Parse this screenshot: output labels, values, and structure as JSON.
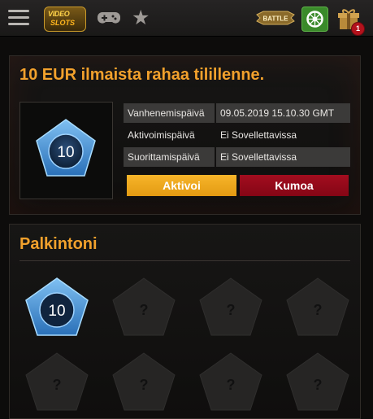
{
  "topbar": {
    "logo_line1": "VIDEO",
    "logo_line2": "SLOTS",
    "battle_label": "BATTLE",
    "notification_count": "1",
    "icons": [
      "menu-icon",
      "gamepad-icon",
      "star-icon",
      "battle-icon",
      "wheel-icon",
      "gift-icon"
    ]
  },
  "offer": {
    "title": "10 EUR ilmaista rahaa tilillenne.",
    "token_value": "10",
    "rows": [
      {
        "label": "Vanhenemispäivä",
        "value": "09.05.2019 15.10.30 GMT"
      },
      {
        "label": "Aktivoimispäivä",
        "value": "Ei Sovellettavissa"
      },
      {
        "label": "Suorittamispäivä",
        "value": "Ei Sovellettavissa"
      }
    ],
    "activate_label": "Aktivoi",
    "cancel_label": "Kumoa"
  },
  "rewards": {
    "title": "Palkintoni",
    "first_value": "10",
    "locked_symbol": "?"
  },
  "colors": {
    "accent_orange": "#f2a12c",
    "activate": "#f5ad22",
    "cancel": "#9b0b1c",
    "token_blue": "#3d8fd6"
  }
}
